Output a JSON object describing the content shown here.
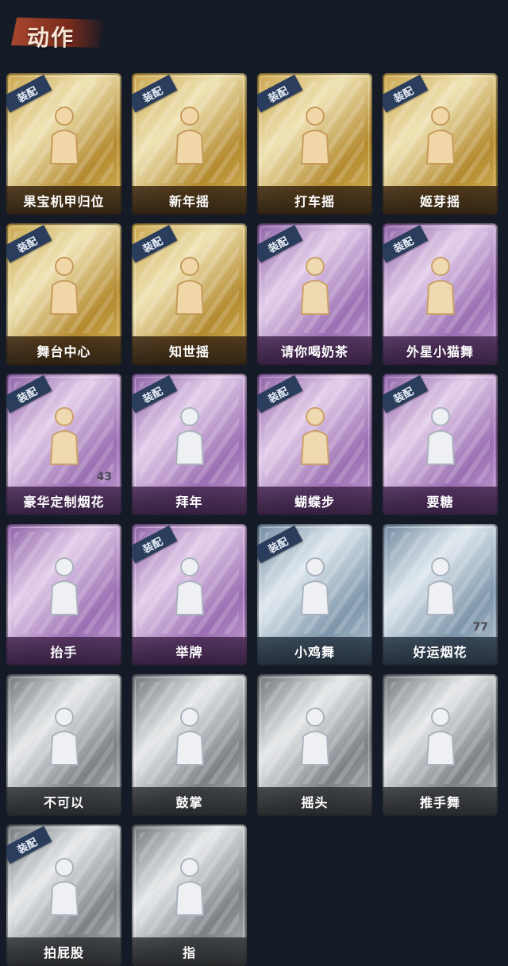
{
  "header": {
    "title": "动作"
  },
  "equip_label": "装配",
  "items": [
    {
      "name": "果宝机甲归位",
      "tier": "gold",
      "equipped": true,
      "icon": "dance-pose-icon",
      "count": ""
    },
    {
      "name": "新年摇",
      "tier": "gold",
      "equipped": true,
      "icon": "clap-pose-icon",
      "count": ""
    },
    {
      "name": "打车摇",
      "tier": "gold",
      "equipped": true,
      "icon": "hail-pose-icon",
      "count": ""
    },
    {
      "name": "姬芽摇",
      "tier": "gold",
      "equipped": true,
      "icon": "wave-pose-icon",
      "count": ""
    },
    {
      "name": "舞台中心",
      "tier": "gold",
      "equipped": true,
      "icon": "point-up-pose-icon",
      "count": ""
    },
    {
      "name": "知世摇",
      "tier": "gold",
      "equipped": true,
      "icon": "sway-pose-icon",
      "count": ""
    },
    {
      "name": "请你喝奶茶",
      "tier": "purple",
      "equipped": true,
      "icon": "sign-pose-icon",
      "count": ""
    },
    {
      "name": "外星小猫舞",
      "tier": "purple",
      "equipped": true,
      "icon": "dab-pose-icon",
      "count": ""
    },
    {
      "name": "豪华定制烟花",
      "tier": "purple",
      "equipped": true,
      "icon": "fireworks-box-icon",
      "count": "43"
    },
    {
      "name": "拜年",
      "tier": "purple",
      "equipped": true,
      "icon": "bow-pose-icon",
      "count": ""
    },
    {
      "name": "蝴蝶步",
      "tier": "purple",
      "equipped": true,
      "icon": "butterfly-step-icon",
      "count": ""
    },
    {
      "name": "要糖",
      "tier": "purple",
      "equipped": true,
      "icon": "reach-out-pose-icon",
      "count": ""
    },
    {
      "name": "抬手",
      "tier": "purple",
      "equipped": false,
      "icon": "raise-hand-icon",
      "count": ""
    },
    {
      "name": "举牌",
      "tier": "purple",
      "equipped": true,
      "icon": "hold-sign-icon",
      "count": ""
    },
    {
      "name": "小鸡舞",
      "tier": "blue",
      "equipped": true,
      "icon": "chicken-dance-icon",
      "count": ""
    },
    {
      "name": "好运烟花",
      "tier": "blue",
      "equipped": false,
      "icon": "firework-can-icon",
      "count": "77"
    },
    {
      "name": "不可以",
      "tier": "gray",
      "equipped": false,
      "icon": "finger-no-icon",
      "count": ""
    },
    {
      "name": "鼓掌",
      "tier": "gray",
      "equipped": false,
      "icon": "applause-icon",
      "count": ""
    },
    {
      "name": "摇头",
      "tier": "gray",
      "equipped": false,
      "icon": "head-shake-icon",
      "count": ""
    },
    {
      "name": "推手舞",
      "tier": "gray",
      "equipped": false,
      "icon": "push-hands-icon",
      "count": ""
    },
    {
      "name": "拍屁股",
      "tier": "gray",
      "equipped": true,
      "icon": "butt-slap-icon",
      "count": ""
    },
    {
      "name": "指",
      "tier": "gray",
      "equipped": false,
      "icon": "point-icon",
      "count": ""
    }
  ]
}
